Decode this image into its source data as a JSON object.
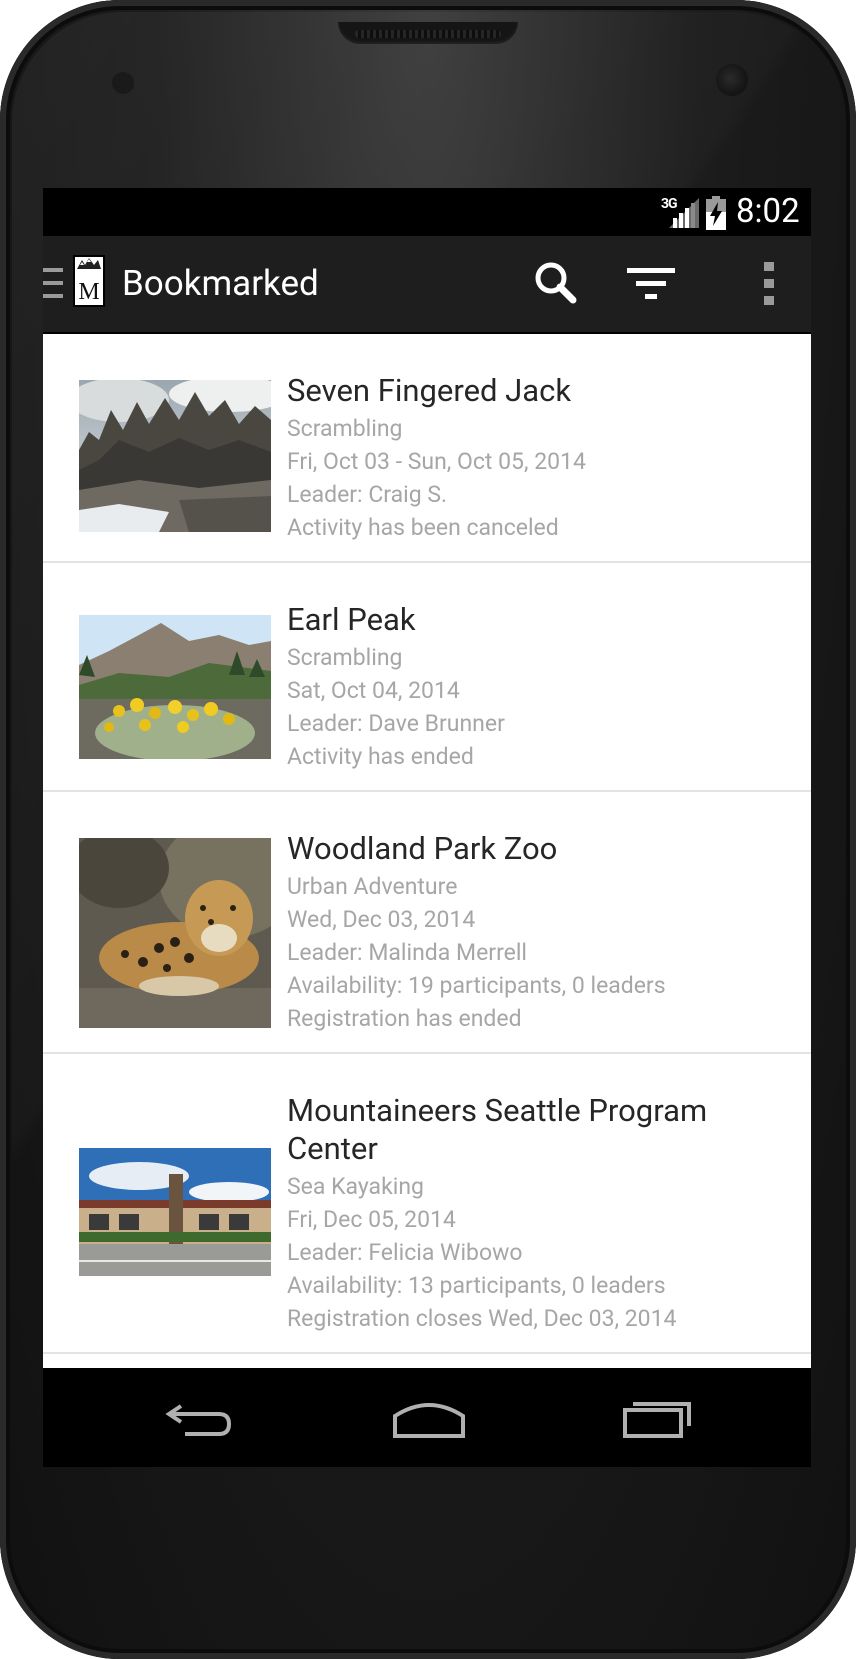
{
  "status_bar": {
    "network": "3G",
    "time": "8:02"
  },
  "action_bar": {
    "title": "Bookmarked",
    "icons": [
      "drawer-icon",
      "mountaineers-logo",
      "search-icon",
      "filter-icon",
      "overflow-menu-icon"
    ]
  },
  "activities": [
    {
      "title": "Seven Fingered Jack",
      "category": "Scrambling",
      "dates": "Fri, Oct 03 - Sun, Oct 05, 2014",
      "leader": "Leader: Craig S.",
      "availability": "",
      "status": "Activity has been canceled"
    },
    {
      "title": "Earl Peak",
      "category": "Scrambling",
      "dates": "Sat, Oct 04, 2014",
      "leader": "Leader: Dave Brunner",
      "availability": "",
      "status": "Activity has ended"
    },
    {
      "title": "Woodland Park Zoo",
      "category": "Urban Adventure",
      "dates": "Wed, Dec 03, 2014",
      "leader": "Leader: Malinda Merrell",
      "availability": "Availability: 19 participants, 0 leaders",
      "status": "Registration has ended"
    },
    {
      "title": "Mountaineers Seattle Program Center",
      "category": "Sea Kayaking",
      "dates": "Fri, Dec 05, 2014",
      "leader": "Leader: Felicia Wibowo",
      "availability": "Availability: 13 participants, 0 leaders",
      "status": "Registration closes Wed, Dec 03, 2014"
    }
  ],
  "nav_bar": {
    "icons": [
      "back-icon",
      "home-icon",
      "recent-apps-icon"
    ]
  },
  "colors": {
    "action_bar": "#1e1e1e",
    "title_text": "#262626",
    "secondary_text": "#a6a6a6",
    "divider": "#e3e3e3"
  }
}
